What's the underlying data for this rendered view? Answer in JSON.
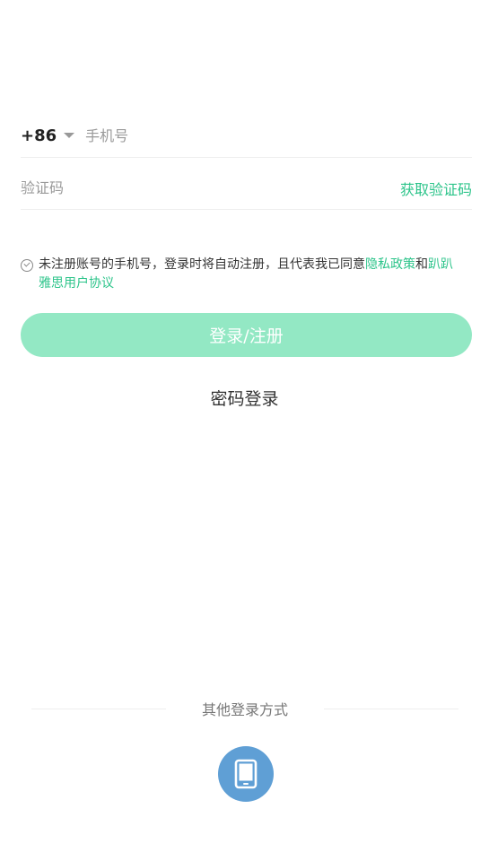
{
  "login": {
    "country_code": "+86",
    "phone_placeholder": "手机号",
    "code_placeholder": "验证码",
    "get_code_label": "获取验证码",
    "agreement": {
      "text": "未注册账号的手机号，登录时将自动注册，且代表我已同意",
      "privacy_link": "隐私政策",
      "conjunction": "和",
      "terms_link": "趴趴雅思用户协议"
    },
    "submit_label": "登录/注册",
    "password_login_label": "密码登录"
  },
  "other_login": {
    "title": "其他登录方式",
    "icons": [
      "phone-icon"
    ],
    "accent_color": "#5f9fd5"
  },
  "colors": {
    "brand_green": "#2cc48a",
    "button_disabled_green": "#93e8c4"
  }
}
